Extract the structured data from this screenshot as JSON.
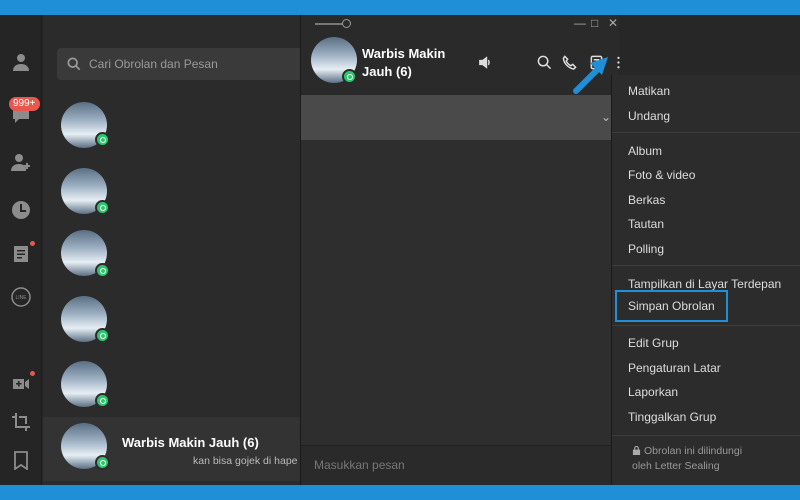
{
  "sidebar": {
    "icons": [
      "person-icon",
      "chat-icon",
      "add-friend-icon",
      "clock-icon",
      "notes-icon",
      "line-icon",
      "video-add-icon",
      "crop-icon",
      "bookmark-icon"
    ],
    "chat_badge": "999+"
  },
  "search": {
    "placeholder": "Cari Obrolan dan Pesan"
  },
  "chat_list": [
    {
      "title": "",
      "preview": ""
    },
    {
      "title": "",
      "preview": ""
    },
    {
      "title": "",
      "preview": ""
    },
    {
      "title": "",
      "preview": ""
    },
    {
      "title": "",
      "preview": ""
    },
    {
      "title": "Warbis Makin Jauh (6)",
      "preview": "kan bisa gojek di hape l"
    }
  ],
  "chat": {
    "title": "Warbis Makin Jauh (6)",
    "input_placeholder": "Masukkan pesan"
  },
  "menu": {
    "items": [
      "Matikan",
      "Undang",
      "Album",
      "Foto & video",
      "Berkas",
      "Tautan",
      "Polling",
      "Tampilkan di Layar Terdepan",
      "Simpan Obrolan",
      "Edit Grup",
      "Pengaturan Latar",
      "Laporkan",
      "Tinggalkan Grup"
    ],
    "footer_line1": "Obrolan ini dilindungi",
    "footer_line2": "oleh Letter Sealing"
  },
  "colors": {
    "accent": "#1f8fd8",
    "badge": "#e8584f",
    "online": "#2ac86d"
  }
}
